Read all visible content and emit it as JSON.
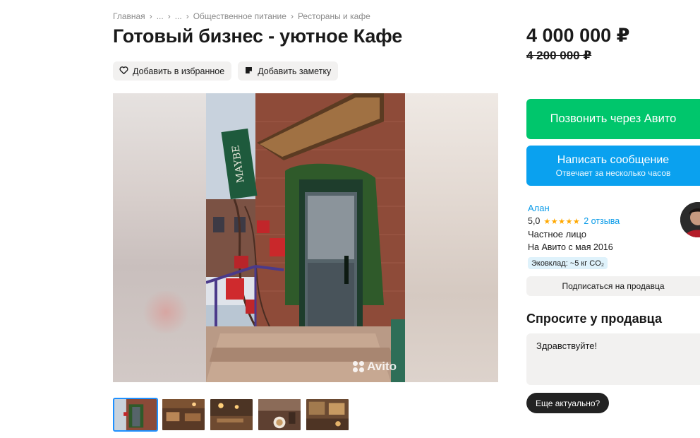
{
  "breadcrumb": {
    "items": [
      "Главная",
      "...",
      "...",
      "Общественное питание",
      "Рестораны и кафе"
    ],
    "separator": "›"
  },
  "listing": {
    "title": "Готовый бизнес - уютное Кафе",
    "price": "4 000 000 ₽",
    "old_price": "4 200 000 ₽"
  },
  "actions": {
    "favorite_label": "Добавить в избранное",
    "note_label": "Добавить заметку"
  },
  "gallery": {
    "sign_text": "MAYBE",
    "watermark": "Avito",
    "thumbnail_count": 5,
    "active_thumbnail": 1
  },
  "contact": {
    "call_label": "Позвонить через Авито",
    "message_label": "Написать сообщение",
    "message_sub": "Отвечает за несколько часов"
  },
  "seller": {
    "name": "Алан",
    "rating": "5,0",
    "stars": "★★★★★",
    "reviews": "2 отзыва",
    "type": "Частное лицо",
    "since": "На Авито с мая 2016",
    "eco": "Эковклад: ~5 кг CO₂",
    "subscribe_label": "Подписаться на продавца"
  },
  "ask": {
    "title": "Спросите у продавца",
    "message_value": "Здравствуйте!",
    "quick_question": "Еще актуально?"
  },
  "colors": {
    "call": "#00c66c",
    "message": "#0aa1ef",
    "link": "#0a9be8",
    "star": "#ffa800"
  }
}
